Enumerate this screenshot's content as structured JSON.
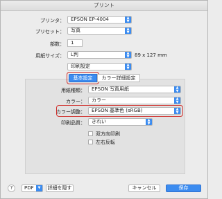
{
  "window": {
    "title": "プリント"
  },
  "printer": {
    "label": "プリンタ：",
    "value": "EPSON EP-4004"
  },
  "preset": {
    "label": "プリセット：",
    "value": "写真"
  },
  "copies": {
    "label": "部数：",
    "value": "1"
  },
  "paper": {
    "label": "用紙サイズ：",
    "value": "L判",
    "dimensions": "89 x 127 mm"
  },
  "section": {
    "value": "印刷設定"
  },
  "tabs": [
    {
      "label": "基本設定",
      "selected": true
    },
    {
      "label": "カラー詳細設定",
      "selected": false
    }
  ],
  "media": {
    "label": "用紙種類：",
    "value": "EPSON 写真用紙"
  },
  "color": {
    "label": "カラー：",
    "value": "カラー"
  },
  "color_adjust": {
    "label": "カラー調整：",
    "value": "EPSON 基準色 (sRGB)"
  },
  "quality": {
    "label": "印刷品質：",
    "value": "きれい"
  },
  "options": [
    {
      "label": "双方向印刷",
      "checked": false
    },
    {
      "label": "左右反転",
      "checked": false
    }
  ],
  "footer": {
    "help": "?",
    "pdf": "PDF",
    "hide_details": "詳細を隠す",
    "cancel": "キャンセル",
    "print": "保存"
  },
  "accent": "#3c8cf0",
  "highlight": "#d0312d"
}
